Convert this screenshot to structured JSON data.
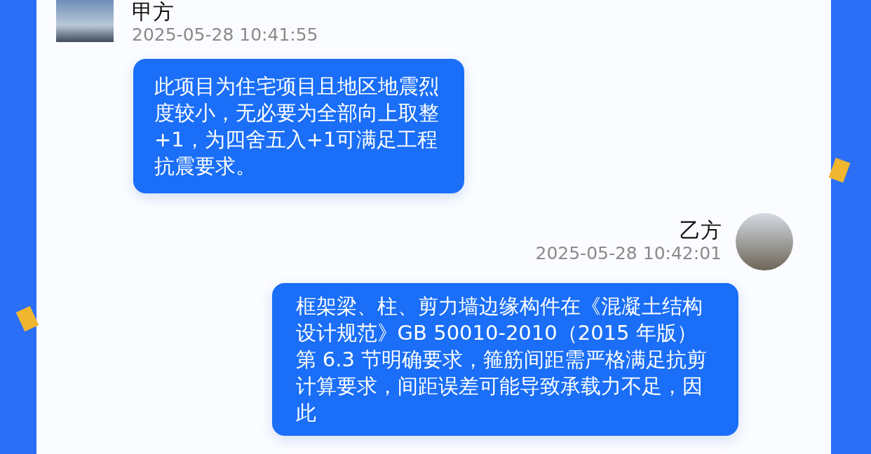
{
  "messages": [
    {
      "kind": "incoming",
      "sender": "甲方",
      "time": "2025-05-28 10:41:55",
      "text": "此项目为住宅项目且地区地震烈度较小，无必要为全部向上取整+1，为四舍五入+1可满足工程抗震要求。"
    },
    {
      "kind": "outgoing",
      "sender": "乙方",
      "time": "2025-05-28 10:42:01",
      "text": "框架梁、柱、剪力墙边缘构件在《混凝土结构设计规范》GB 50010-2010（2015 年版）第 6.3 节明确要求，箍筋间距需严格满足抗剪计算要求，间距误差可能导致承载力不足，因此"
    }
  ]
}
